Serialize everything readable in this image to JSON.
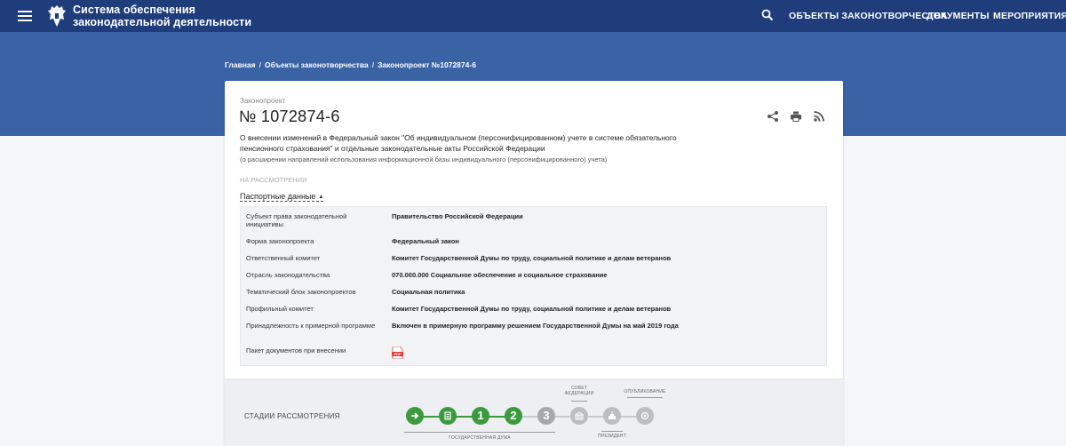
{
  "header": {
    "title_line1": "Система обеспечения",
    "title_line2": "законодательной деятельности",
    "nav": [
      "ОБЪЕКТЫ ЗАКОНОТВОРЧЕСТВА",
      "ДОКУМЕНТЫ",
      "МЕРОПРИЯТИЯ"
    ],
    "colors": {
      "header_bg": "#1f3c7b",
      "hero_bg": "#3a63a6",
      "accent_green": "#3b9a3c"
    }
  },
  "breadcrumb": [
    "Главная",
    "Объекты законотворчества",
    "Законопроект №1072874-6"
  ],
  "bill": {
    "kind": "Законопроект",
    "number": "№ 1072874-6",
    "title": "О внесении изменений в Федеральный закон \"Об индивидуальном (персонифицированном) учете в системе обязательного пенсионного страхования\" и отдельные законодательные акты Российской Федерации",
    "subtitle": "(о расширении направлений использования информационной базы индивидуального (персонифицированного) учета)",
    "status": "НА РАССМОТРЕНИИ",
    "actions": [
      "share-icon",
      "print-icon",
      "rss-icon"
    ]
  },
  "passport": {
    "toggle_label": "Паспортные данные",
    "rows": [
      {
        "key": "Субъект права законодательной инициативы",
        "value": "Правительство Российской Федерации"
      },
      {
        "key": "Форма законопроекта",
        "value": "Федеральный закон"
      },
      {
        "key": "Ответственный комитет",
        "value": "Комитет Государственной Думы по труду, социальной политике и делам ветеранов"
      },
      {
        "key": "Отрасль законодательства",
        "value": "070.000.000 Социальное обеспечение и социальное страхование"
      },
      {
        "key": "Тематический блок законопроектов",
        "value": "Социальная политика"
      },
      {
        "key": "Профильный комитет",
        "value": "Комитет Государственной Думы по труду, социальной политике и делам ветеранов"
      },
      {
        "key": "Принадлежность к примерной программе",
        "value": "Включен в примерную программу решением Государственной Думы на май 2019 года"
      },
      {
        "key": "Пакет документов при внесении",
        "value": ""
      }
    ],
    "pdf_icon_label": "PDF"
  },
  "stages": {
    "label": "СТАДИИ РАССМОТРЕНИЯ",
    "steps": [
      {
        "icon": "arrow-right-icon",
        "state": "done"
      },
      {
        "icon": "document-icon",
        "state": "done"
      },
      {
        "text": "1",
        "state": "done"
      },
      {
        "text": "2",
        "state": "done"
      },
      {
        "text": "3",
        "state": "pending"
      },
      {
        "icon": "federation-council-icon",
        "state": "pending"
      },
      {
        "icon": "president-icon",
        "state": "pending"
      },
      {
        "icon": "publication-icon",
        "state": "pending"
      }
    ],
    "captions": {
      "council": "СОВЕТ ФЕДЕРАЦИИ",
      "publication": "ОПУБЛИКОВАНИЕ",
      "duma": "ГОСУДАРСТВЕННАЯ ДУМА",
      "president": "ПРЕЗИДЕНТ"
    }
  }
}
